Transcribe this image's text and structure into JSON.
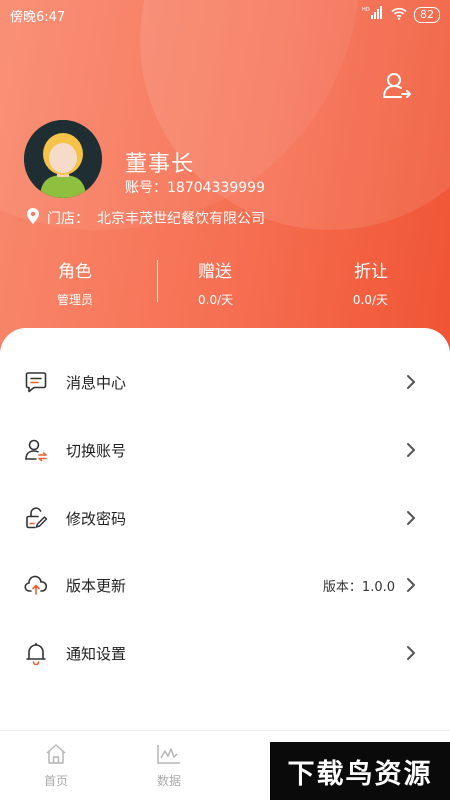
{
  "statusbar": {
    "time": "傍晚6:47",
    "signal": "HD",
    "battery": "82"
  },
  "profile": {
    "name": "董事长",
    "account_label": "账号：",
    "account_value": "18704339999",
    "store_label": "门店：",
    "store_value": "北京丰茂世纪餐饮有限公司"
  },
  "stats": [
    {
      "label": "角色",
      "value": "管理员"
    },
    {
      "label": "赠送",
      "value": "0.0/天"
    },
    {
      "label": "折让",
      "value": "0.0/天"
    }
  ],
  "menu": [
    {
      "label": "消息中心",
      "icon": "message-icon"
    },
    {
      "label": "切换账号",
      "icon": "switch-user-icon"
    },
    {
      "label": "修改密码",
      "icon": "edit-password-icon"
    },
    {
      "label": "版本更新",
      "icon": "cloud-upload-icon",
      "extra": "版本：1.0.0"
    },
    {
      "label": "通知设置",
      "icon": "bell-icon"
    }
  ],
  "tabs": [
    {
      "label": "首页",
      "icon": "home-icon"
    },
    {
      "label": "数据",
      "icon": "chart-icon"
    }
  ],
  "watermark": "下载鸟资源",
  "colors": {
    "accent": "#f66f52",
    "accent_dark": "#ef5433",
    "icon_orange": "#e8602c"
  }
}
